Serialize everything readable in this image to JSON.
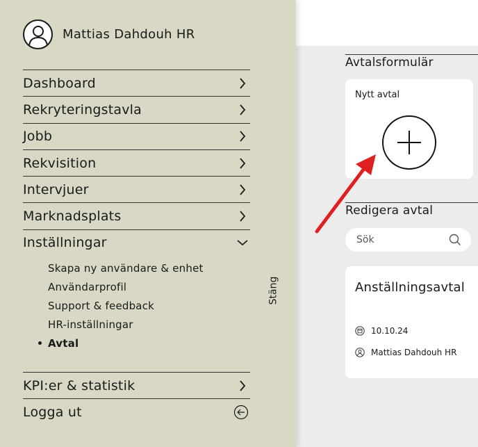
{
  "user": {
    "name": "Mattias Dahdouh HR",
    "avatar_icon": "user-icon"
  },
  "nav": {
    "items": [
      {
        "label": "Dashboard",
        "icon": "chevron-right-icon"
      },
      {
        "label": "Rekryteringstavla",
        "icon": "chevron-right-icon"
      },
      {
        "label": "Jobb",
        "icon": "chevron-right-icon"
      },
      {
        "label": "Rekvisition",
        "icon": "chevron-right-icon"
      },
      {
        "label": "Intervjuer",
        "icon": "chevron-right-icon"
      },
      {
        "label": "Marknadsplats",
        "icon": "chevron-right-icon"
      },
      {
        "label": "Inställningar",
        "icon": "chevron-down-icon",
        "expanded": true
      }
    ],
    "sub_items": [
      {
        "label": "Skapa ny användare & enhet"
      },
      {
        "label": "Användarprofil"
      },
      {
        "label": "Support & feedback"
      },
      {
        "label": "HR-inställningar"
      },
      {
        "label": "Avtal",
        "active": true
      }
    ],
    "bottom": [
      {
        "label": "KPI:er & statistik",
        "icon": "chevron-right-icon"
      },
      {
        "label": "Logga ut",
        "icon": "logout-arrow-icon"
      }
    ],
    "close_label": "Stäng"
  },
  "main": {
    "forms_title": "Avtalsformulär",
    "new_contract_label": "Nytt avtal",
    "edit_title": "Redigera avtal",
    "search_placeholder": "Sök",
    "contract": {
      "title": "Anställningsavtal",
      "date": "10.10.24",
      "author": "Mattias Dahdouh HR"
    }
  },
  "colors": {
    "sidebar_bg": "#d8d8c4",
    "main_bg": "#ececec",
    "annotation_arrow": "#e02020"
  }
}
